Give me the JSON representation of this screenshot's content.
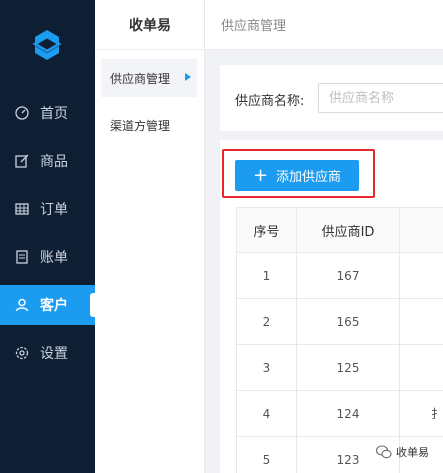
{
  "nav": {
    "items": [
      {
        "label": "首页",
        "icon": "dashboard-icon"
      },
      {
        "label": "商品",
        "icon": "edit-icon"
      },
      {
        "label": "订单",
        "icon": "table-icon"
      },
      {
        "label": "账单",
        "icon": "bill-icon"
      },
      {
        "label": "客户",
        "icon": "user-icon",
        "active": true
      },
      {
        "label": "设置",
        "icon": "gear-icon"
      }
    ]
  },
  "sub": {
    "title": "收单易",
    "items": [
      {
        "label": "供应商管理",
        "active": true
      },
      {
        "label": "渠道方管理"
      }
    ]
  },
  "header": {
    "breadcrumb": "供应商管理"
  },
  "filter": {
    "label": "供应商名称:",
    "placeholder": "供应商名称",
    "value": ""
  },
  "actions": {
    "add_label": "添加供应商",
    "add_icon": "plus-icon"
  },
  "table": {
    "headers": [
      "序号",
      "供应商ID"
    ],
    "rows": [
      {
        "index": "1",
        "id": "167",
        "extra": ""
      },
      {
        "index": "2",
        "id": "165",
        "extra": ""
      },
      {
        "index": "3",
        "id": "125",
        "extra": ""
      },
      {
        "index": "4",
        "id": "124",
        "extra": "扌"
      },
      {
        "index": "5",
        "id": "123",
        "extra": ""
      }
    ]
  },
  "watermark": {
    "text": "收单易"
  },
  "colors": {
    "nav_bg": "#0f1f33",
    "accent": "#1c9cf0",
    "highlight": "#e8262d"
  }
}
